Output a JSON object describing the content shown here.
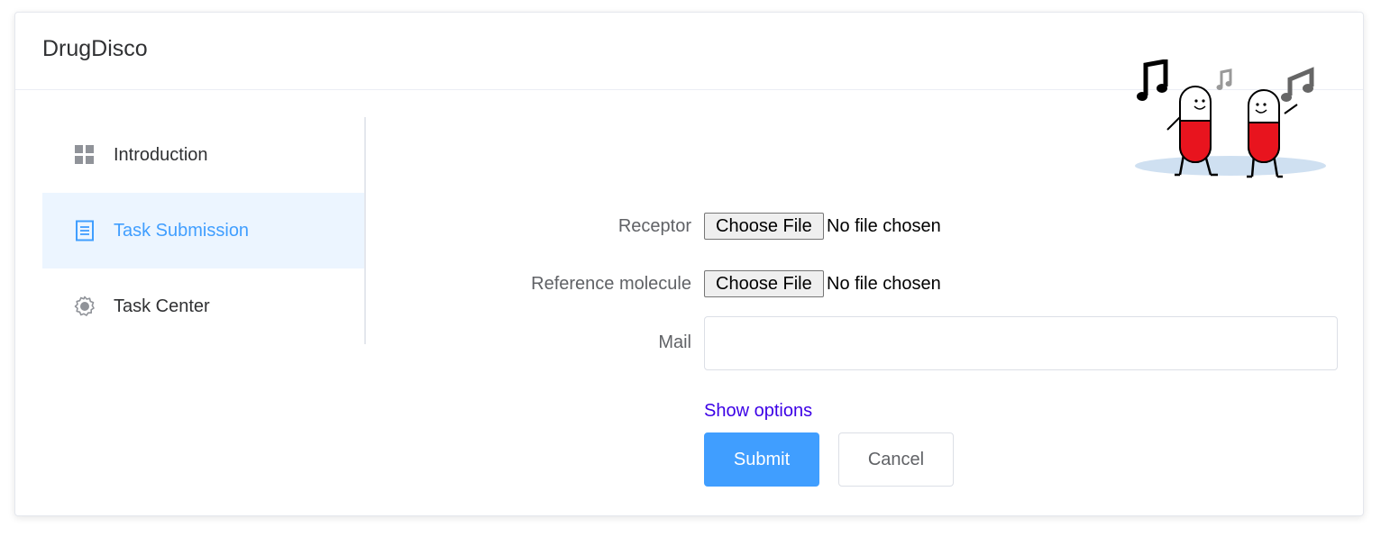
{
  "app": {
    "title": "DrugDisco"
  },
  "sidebar": {
    "items": [
      {
        "label": "Introduction",
        "icon": "grid-icon",
        "active": false
      },
      {
        "label": "Task Submission",
        "icon": "document-icon",
        "active": true
      },
      {
        "label": "Task Center",
        "icon": "gear-icon",
        "active": false
      }
    ]
  },
  "form": {
    "receptor": {
      "label": "Receptor",
      "button_label": "Choose File",
      "status": "No file chosen"
    },
    "reference_molecule": {
      "label": "Reference molecule",
      "button_label": "Choose File",
      "status": "No file chosen"
    },
    "mail": {
      "label": "Mail",
      "value": "",
      "placeholder": ""
    },
    "show_options_label": "Show options",
    "submit_label": "Submit",
    "cancel_label": "Cancel"
  },
  "colors": {
    "accent": "#409eff",
    "active_bg": "#ecf5ff",
    "link": "#3c00e6",
    "pill_red": "#e8141e"
  }
}
